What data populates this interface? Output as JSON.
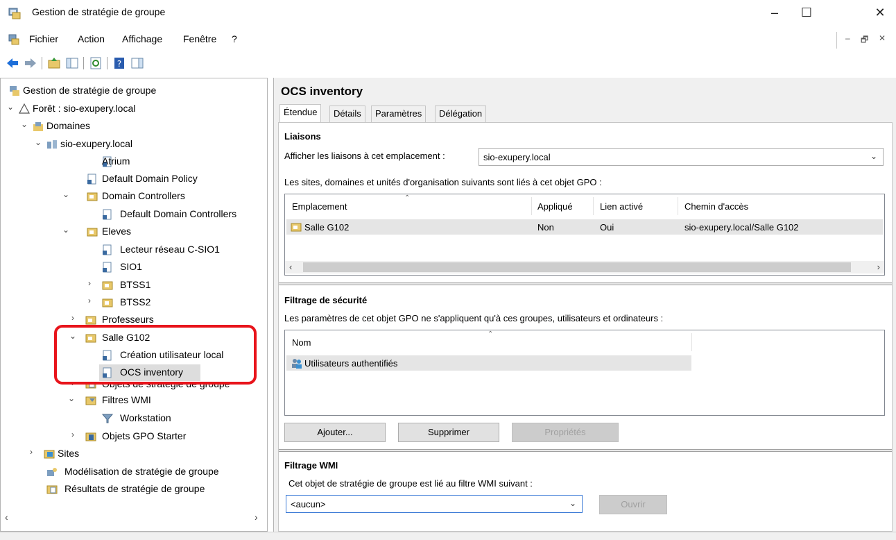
{
  "window": {
    "title": "Gestion de stratégie de groupe",
    "minimize": "–",
    "maximize": "☐",
    "close": "✕"
  },
  "menu": {
    "items": [
      "Fichier",
      "Action",
      "Affichage",
      "Fenêtre",
      "?"
    ],
    "mdi": [
      "–",
      "🗗",
      "✕"
    ]
  },
  "toolbar": {
    "icons": [
      "back-arrow-icon",
      "forward-arrow-icon",
      "up-folder-icon",
      "show-hide-tree-icon",
      "refresh-icon",
      "help-icon",
      "show-action-pane-icon"
    ]
  },
  "tree": {
    "root": "Gestion de stratégie de groupe",
    "forest": "Forêt : sio-exupery.local",
    "domains": "Domaines",
    "domain": "sio-exupery.local",
    "atrium": "Atrium",
    "default_domain_policy": "Default Domain Policy",
    "domain_controllers": "Domain Controllers",
    "default_domain_controllers": "Default Domain Controllers",
    "eleves": "Eleves",
    "lecteur": "Lecteur réseau C-SIO1",
    "sio1": "SIO1",
    "btss1": "BTSS1",
    "btss2": "BTSS2",
    "professeurs": "Professeurs",
    "salle": "Salle G102",
    "creation": "Création utilisateur local",
    "ocs": "OCS inventory",
    "objets_strategie": "Objets de stratégie de groupe",
    "filtres_wmi": "Filtres WMI",
    "workstation": "Workstation",
    "objets_starter": "Objets GPO Starter",
    "sites": "Sites",
    "modelisation": "Modélisation de stratégie de groupe",
    "resultats": "Résultats de stratégie de groupe"
  },
  "details": {
    "title": "OCS inventory",
    "tabs": [
      "Étendue",
      "Détails",
      "Paramètres",
      "Délégation"
    ],
    "liaisons": {
      "title": "Liaisons",
      "show_label": "Afficher les liaisons à cet emplacement :",
      "location_value": "sio-exupery.local",
      "desc": "Les sites, domaines et unités d'organisation suivants sont liés à cet objet GPO :",
      "columns": [
        "Emplacement",
        "Appliqué",
        "Lien activé",
        "Chemin d'accès"
      ],
      "rows": [
        {
          "emplacement": "Salle G102",
          "applique": "Non",
          "lien": "Oui",
          "chemin": "sio-exupery.local/Salle G102"
        }
      ]
    },
    "securite": {
      "title": "Filtrage de sécurité",
      "desc": "Les paramètres de cet objet GPO ne s'appliquent qu'à ces groupes, utilisateurs et ordinateurs :",
      "column": "Nom",
      "rows": [
        "Utilisateurs authentifiés"
      ],
      "add": "Ajouter...",
      "remove": "Supprimer",
      "properties": "Propriétés"
    },
    "wmi": {
      "title": "Filtrage WMI",
      "desc": "Cet objet de stratégie de groupe est lié au filtre WMI suivant :",
      "value": "<aucun>",
      "open": "Ouvrir"
    }
  }
}
